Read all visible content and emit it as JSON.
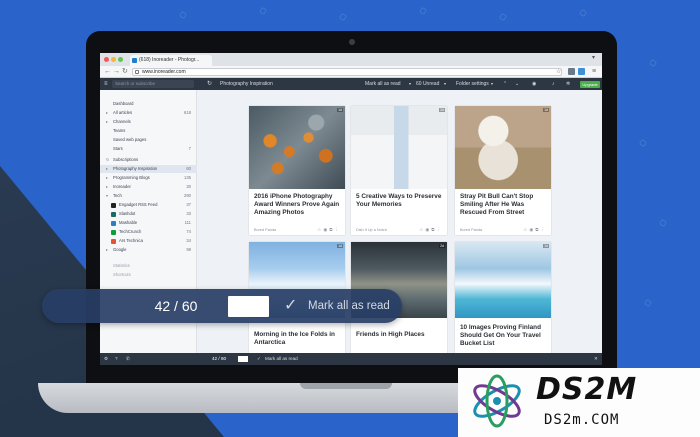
{
  "browser": {
    "tab_title": "(618) Inoreader - Photogr...",
    "url": "www.inoreader.com"
  },
  "toolbar": {
    "search_placeholder": "Search or subscribe",
    "feed_title": "Photography Inspiration",
    "mark_all_read": "Mark all as read",
    "unread": "60 Unread",
    "folder_settings": "Folder settings",
    "upgrade": "Upgrade"
  },
  "sidebar": {
    "items": [
      {
        "label": "Dashboard",
        "count": ""
      },
      {
        "label": "All articles",
        "count": "618"
      },
      {
        "label": "Channels",
        "count": ""
      },
      {
        "label": "Teams",
        "count": ""
      },
      {
        "label": "Saved web pages",
        "count": ""
      },
      {
        "label": "Stars",
        "count": "7"
      },
      {
        "label": "Subscriptions",
        "count": ""
      },
      {
        "label": "Photography Inspiration",
        "count": "60"
      },
      {
        "label": "Programming Blogs",
        "count": "135"
      },
      {
        "label": "Inoreader",
        "count": "30"
      },
      {
        "label": "Tech",
        "count": "290"
      },
      {
        "label": "Engadget RSS Feed",
        "count": "37"
      },
      {
        "label": "Slashdot",
        "count": "33"
      },
      {
        "label": "Mashable",
        "count": "111"
      },
      {
        "label": "TechCrunch",
        "count": "74"
      },
      {
        "label": "Ars Technica",
        "count": "34"
      },
      {
        "label": "Google",
        "count": "99"
      },
      {
        "label": "Statistics",
        "count": ""
      },
      {
        "label": "Shortcuts",
        "count": ""
      }
    ]
  },
  "cards": [
    {
      "title": "2016 iPhone Photography Award Winners Prove Again Amazing Photos",
      "source": "Bored Panda",
      "badge": "1d"
    },
    {
      "title": "5 Creative Ways to Preserve Your Memories",
      "source": "Dish It Up a Notch",
      "badge": "2d"
    },
    {
      "title": "Stray Pit Bull Can't Stop Smiling After He Was Rescued From Street",
      "source": "Bored Panda",
      "badge": "1d"
    },
    {
      "title": "Morning in the Ice Folds in Antarctica",
      "source": "",
      "badge": "1d"
    },
    {
      "title": "Friends in High Places",
      "source": "",
      "badge": "2d"
    },
    {
      "title": "10 Images Proving Finland Should Get On Your Travel Bucket List",
      "source": "",
      "badge": "1d"
    }
  ],
  "statusbar": {
    "count": "42 / 60",
    "mark_all_read": "Mark all as read"
  },
  "overlay": {
    "count": "42 / 60",
    "mark_all_read": "Mark all as read"
  },
  "watermark": {
    "big": "DS2M",
    "small": "DS2m.COM"
  }
}
